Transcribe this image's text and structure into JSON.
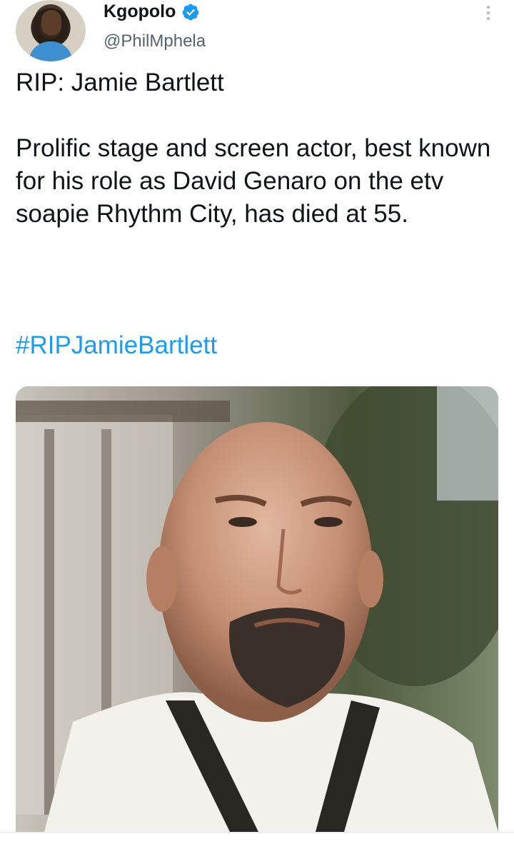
{
  "tweet": {
    "author": {
      "display_name": "Kgopolo",
      "handle": "@PhilMphela",
      "verified_icon": "verified-badge-icon",
      "avatar": "avatar"
    },
    "text": "RIP: Jamie Bartlett\n\nProlific stage and screen actor, best known for his role as David Genaro on the etv soapie Rhythm City,  has died at 55.",
    "hashtag": "#RIPJamieBartlett",
    "media": {
      "image": "portrait-photo"
    },
    "colors": {
      "link": "#1d9bf0",
      "verified": "#1d9bf0",
      "secondary_text": "#536471"
    }
  }
}
